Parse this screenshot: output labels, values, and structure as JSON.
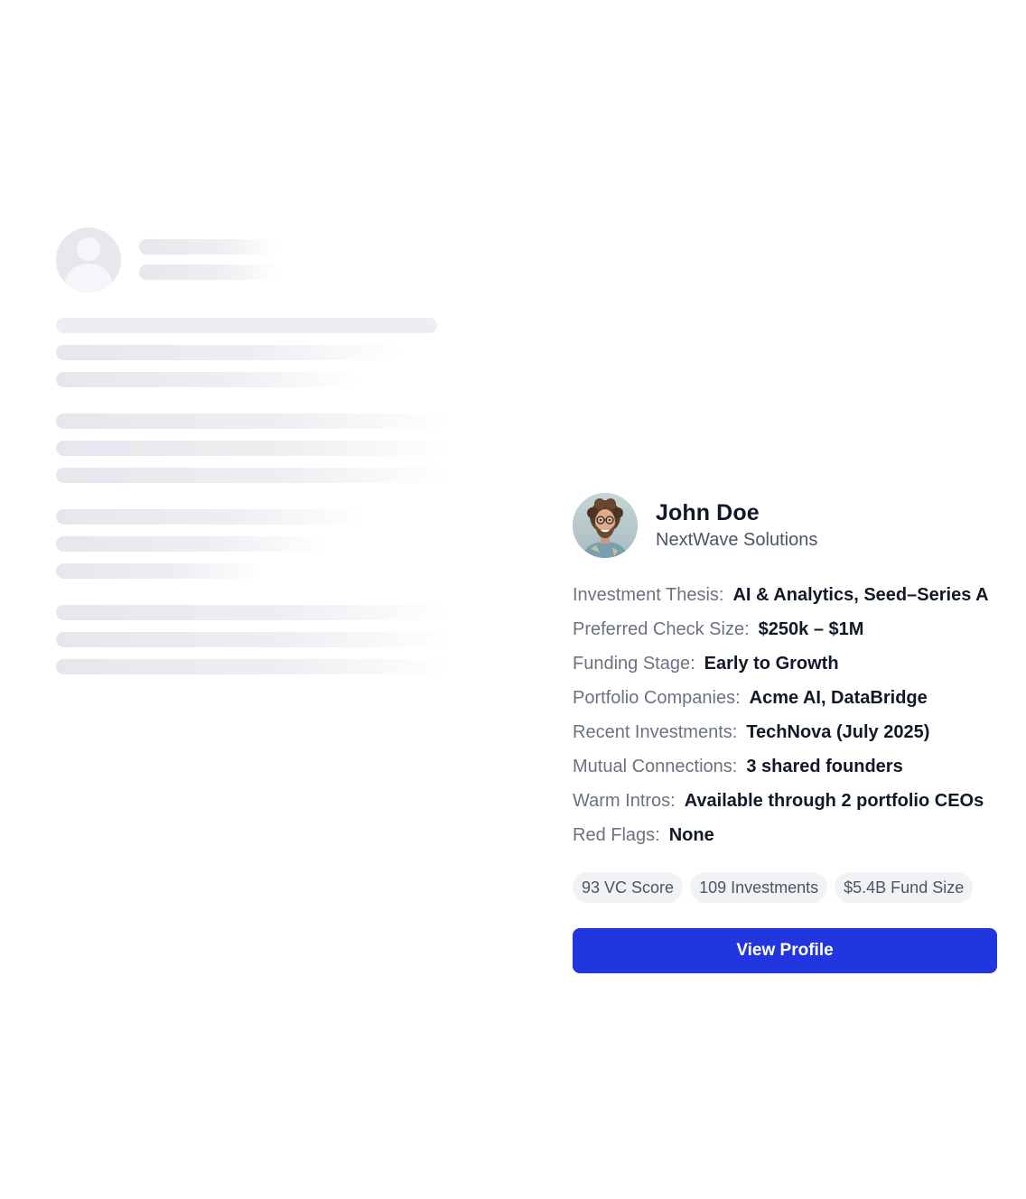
{
  "profile": {
    "name": "John Doe",
    "company": "NextWave Solutions",
    "details": [
      {
        "label": "Investment Thesis:",
        "value": "AI & Analytics, Seed–Series A"
      },
      {
        "label": "Preferred Check Size:",
        "value": "$250k – $1M"
      },
      {
        "label": "Funding Stage:",
        "value": "Early to Growth"
      },
      {
        "label": "Portfolio Companies:",
        "value": "Acme AI, DataBridge"
      },
      {
        "label": "Recent Investments:",
        "value": "TechNova (July 2025)"
      },
      {
        "label": "Mutual Connections:",
        "value": "3 shared founders"
      },
      {
        "label": "Warm Intros:",
        "value": "Available through 2 portfolio CEOs"
      },
      {
        "label": "Red Flags:",
        "value": "None"
      }
    ],
    "chips": [
      "93 VC Score",
      "109 Investments",
      "$5.4B Fund Size"
    ],
    "button_label": "View Profile"
  },
  "colors": {
    "accent": "#2236e0",
    "label": "#6b7280",
    "value": "#111827",
    "chip_bg": "#f1f2f6",
    "skeleton": "#e5e7ec"
  },
  "icons": {
    "skeleton_avatar": "user-placeholder-icon"
  }
}
